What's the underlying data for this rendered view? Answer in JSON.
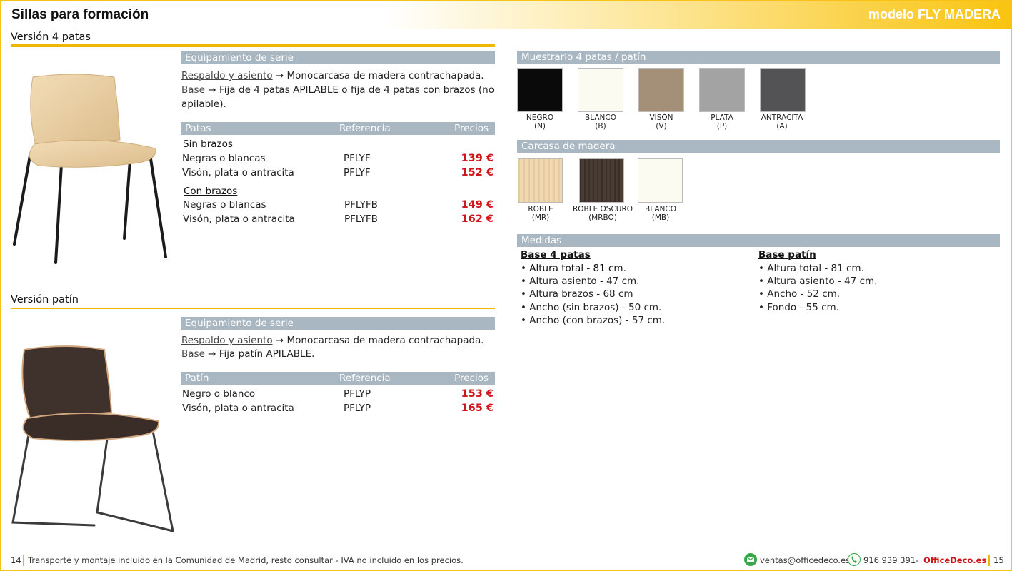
{
  "header": {
    "title": "Sillas para formación",
    "model": "modelo FLY MADERA"
  },
  "section1": {
    "title": "Versión 4 patas",
    "equip_bar": "Equipamiento de serie",
    "respaldo_label": "Respaldo y asiento",
    "respaldo_text": "→ Monocarcasa de madera contrachapada.",
    "base_label": "Base",
    "base_text": "→ Fija de 4 patas APILABLE o fija de 4 patas con brazos (no apilable).",
    "table_headers": [
      "Patas",
      "Referencia",
      "Precios"
    ],
    "groups": [
      {
        "title": "Sin brazos",
        "rows": [
          {
            "name": "Negras o blancas",
            "ref": "PFLYF",
            "price": "139 €"
          },
          {
            "name": "Visón, plata o antracita",
            "ref": "PFLYF",
            "price": "152 €"
          }
        ]
      },
      {
        "title": "Con brazos",
        "rows": [
          {
            "name": "Negras o blancas",
            "ref": "PFLYFB",
            "price": "149 €"
          },
          {
            "name": "Visón, plata o antracita",
            "ref": "PFLYFB",
            "price": "162 €"
          }
        ]
      }
    ]
  },
  "section2": {
    "title": "Versión patín",
    "equip_bar": "Equipamiento de serie",
    "respaldo_label": "Respaldo y asiento",
    "respaldo_text": "→ Monocarcasa de madera contrachapada.",
    "base_label": "Base",
    "base_text": "→ Fija patín APILABLE.",
    "table_headers": [
      "Patín",
      "Referencia",
      "Precios"
    ],
    "rows": [
      {
        "name": "Negro o blanco",
        "ref": "PFLYP",
        "price": "153 €"
      },
      {
        "name": "Visón, plata o antracita",
        "ref": "PFLYP",
        "price": "165 €"
      }
    ]
  },
  "muestrario": {
    "title": "Muestrario 4 patas / patín",
    "swatches": [
      {
        "name": "NEGRO",
        "code": "(N)",
        "color": "#0a0a0a"
      },
      {
        "name": "BLANCO",
        "code": "(B)",
        "color": "#fbfbf1"
      },
      {
        "name": "VISÓN",
        "code": "(V)",
        "color": "#a49079"
      },
      {
        "name": "PLATA",
        "code": "(P)",
        "color": "#a3a3a3"
      },
      {
        "name": "ANTRACITA",
        "code": "(A)",
        "color": "#535356"
      }
    ]
  },
  "carcasa": {
    "title": "Carcasa de madera",
    "swatches": [
      {
        "name": "ROBLE",
        "code": "(MR)",
        "color": "#f1d8b0"
      },
      {
        "name": "ROBLE OSCURO",
        "code": "(MRBO)",
        "color": "#4a3b35"
      },
      {
        "name": "BLANCO",
        "code": "(MB)",
        "color": "#fbfbf1"
      }
    ]
  },
  "medidas": {
    "title": "Medidas",
    "base4_title": "Base 4 patas",
    "base4_items": [
      "Altura total - 81 cm.",
      "Altura asiento - 47 cm.",
      "Altura brazos - 68 cm",
      "Ancho (sin brazos) - 50 cm.",
      "Ancho (con brazos) - 57 cm."
    ],
    "patin_title": "Base patín",
    "patin_items": [
      "Altura total - 81 cm.",
      "Altura asiento - 47 cm.",
      "Ancho - 52 cm.",
      "Fondo - 55 cm."
    ]
  },
  "footer": {
    "page_left": "14",
    "note": "Transporte y montaje incluido en la Comunidad de Madrid, resto consultar - IVA no incluido en los precios.",
    "email": "ventas@officedeco.es",
    "phone": "916 939 391",
    "dash": "-",
    "brand": "OfficeDeco.es",
    "page_right": "15"
  }
}
